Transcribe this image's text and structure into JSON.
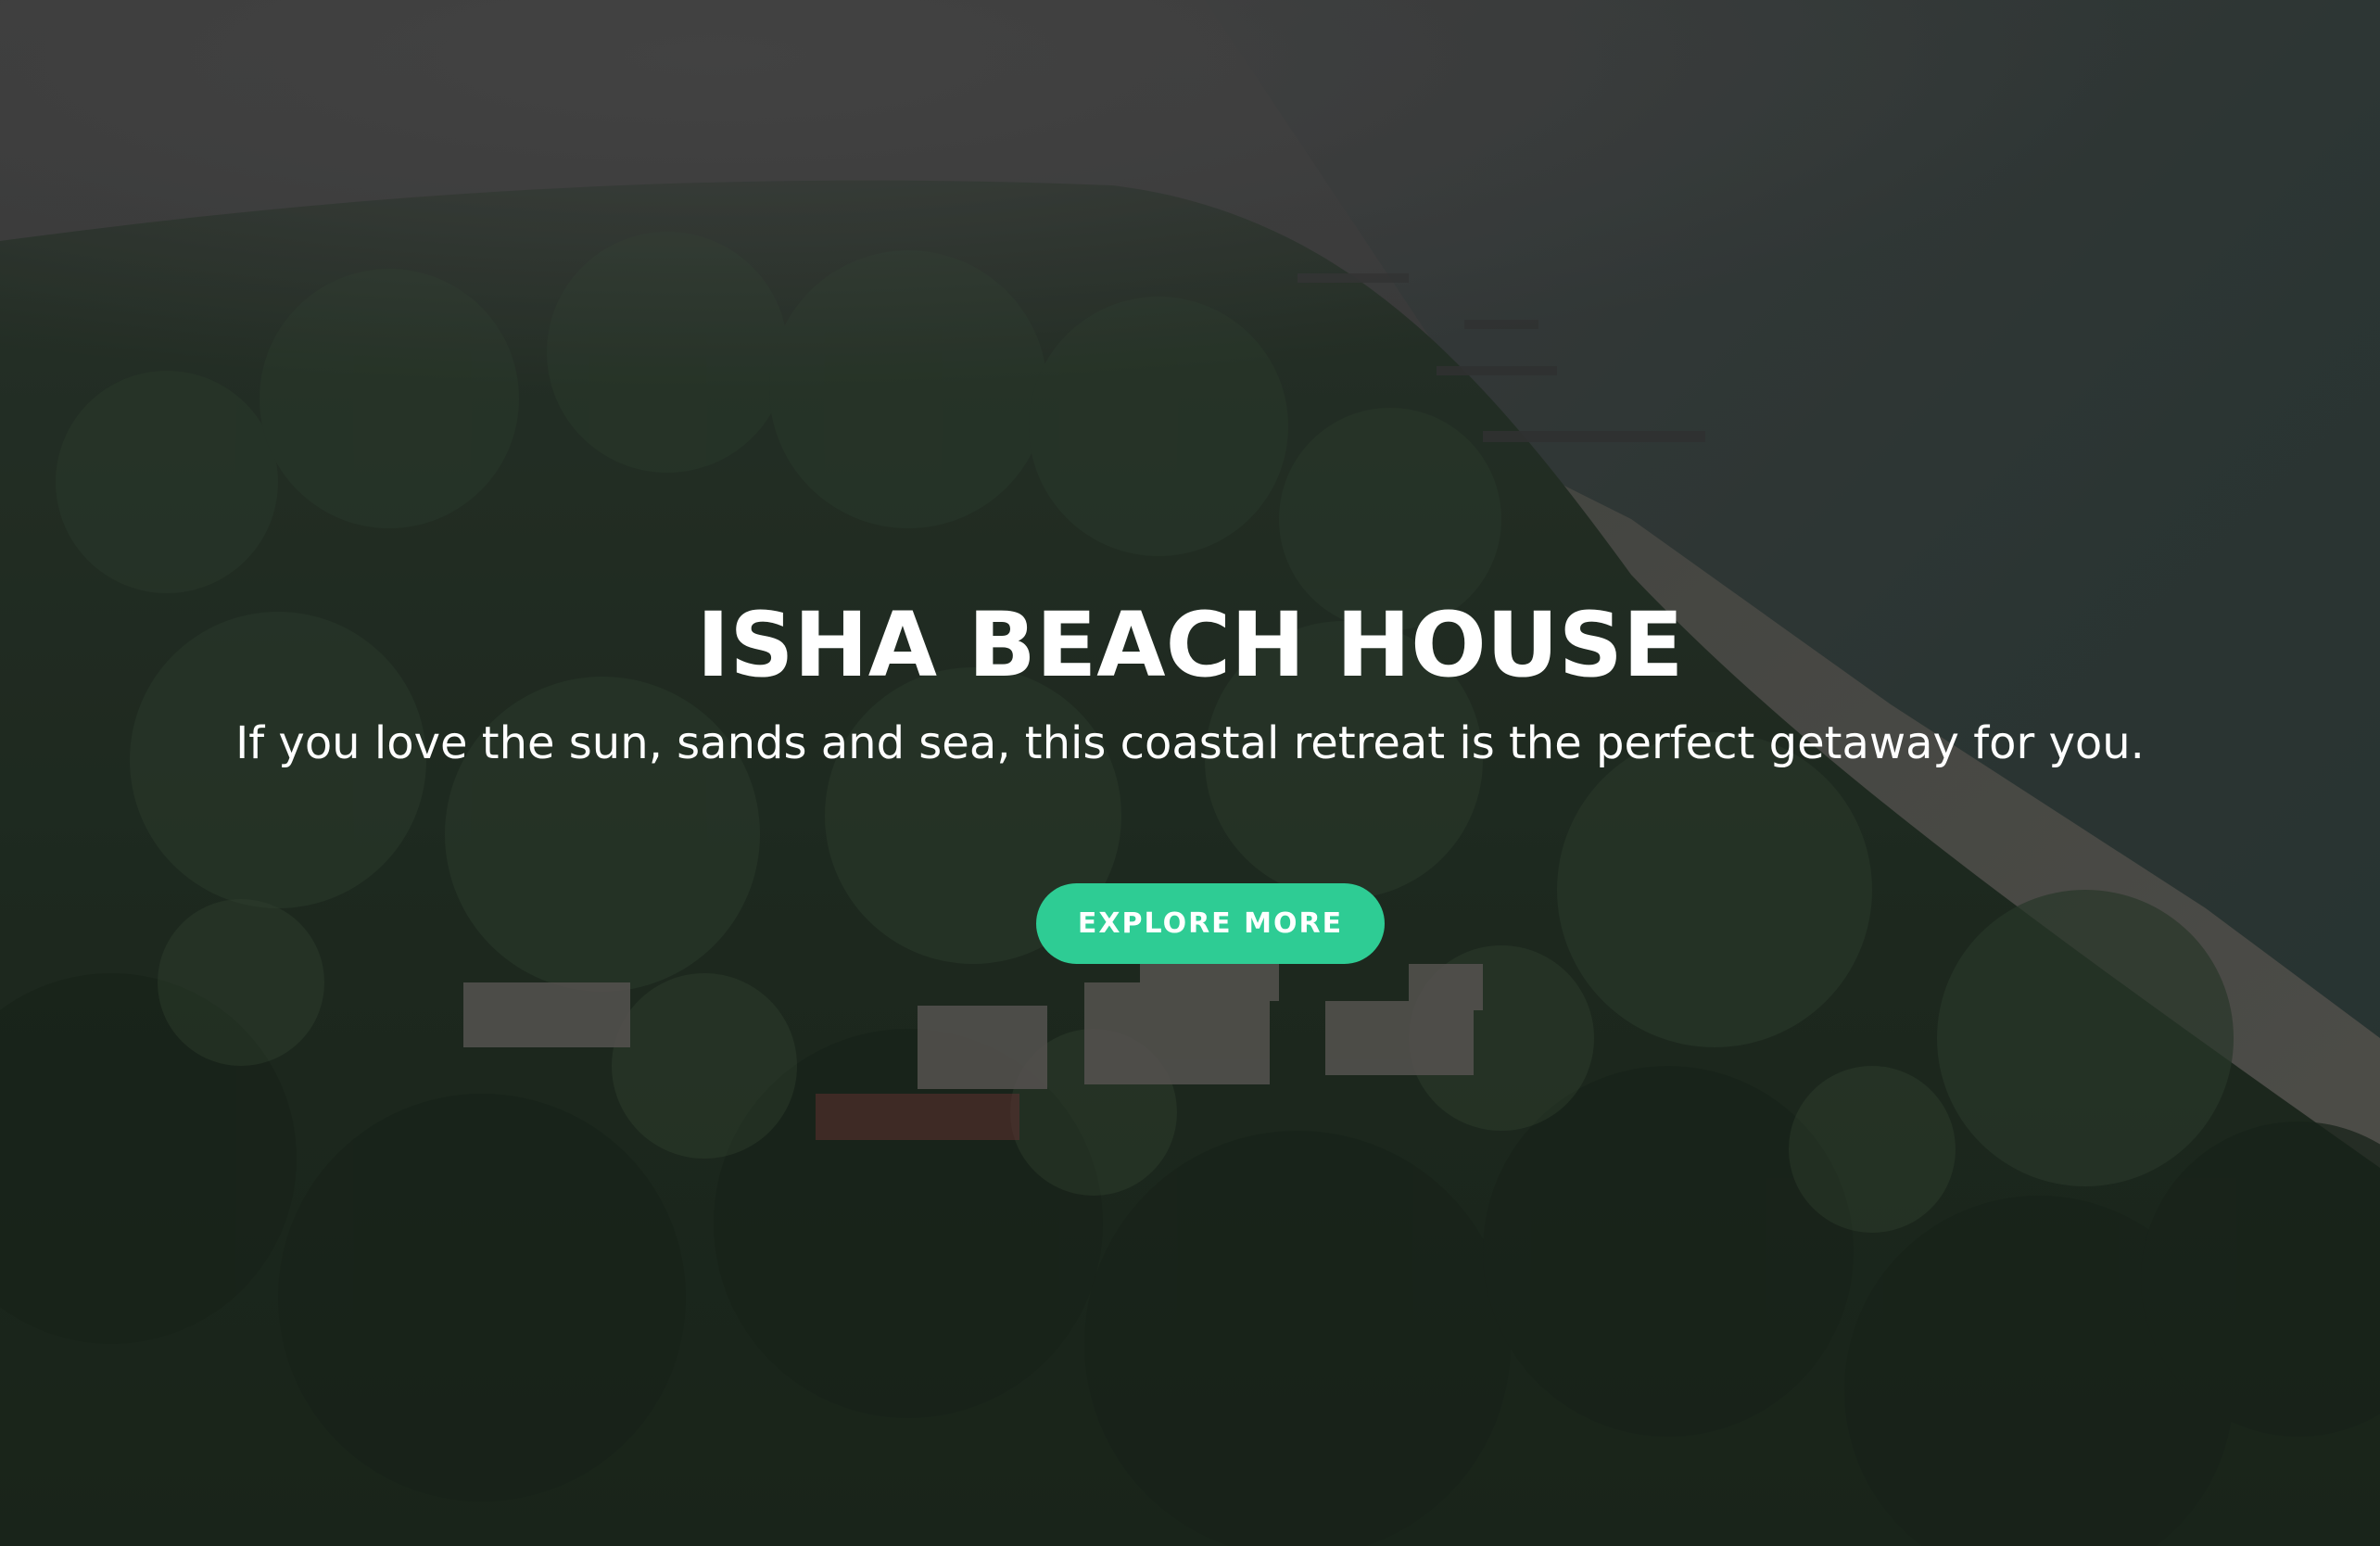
{
  "hero": {
    "title": "ISHA BEACH HOUSE",
    "subtitle": "If you love the sun, sands and sea, this coastal retreat is the perfect getaway for you.",
    "button_label": "EXPLORE MORE",
    "background": "aerial-view-forested-coastline-with-villas"
  },
  "colors": {
    "button_bg": "#2ecc94",
    "text": "#ffffff",
    "overlay": "#000000"
  }
}
